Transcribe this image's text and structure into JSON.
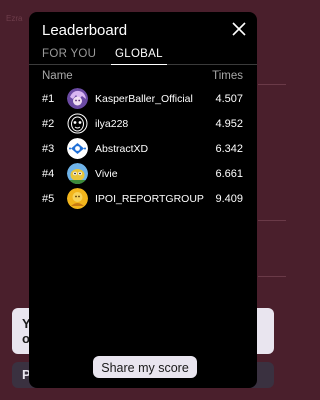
{
  "background": {
    "faint_label": "Ezra",
    "card_text": "Yo",
    "pill_text": "P"
  },
  "modal": {
    "title": "Leaderboard",
    "tabs": [
      {
        "label": "FOR YOU",
        "active": false
      },
      {
        "label": "GLOBAL",
        "active": true
      }
    ],
    "columns": {
      "name": "Name",
      "times": "Times"
    },
    "rows": [
      {
        "rank": "#1",
        "name": "KasperBaller_Official",
        "time": "4.507",
        "avatar": "purple-anime-avatar"
      },
      {
        "rank": "#2",
        "name": "ilya228",
        "time": "4.952",
        "avatar": "mask-avatar"
      },
      {
        "rank": "#3",
        "name": "AbstractXD",
        "time": "6.342",
        "avatar": "blue-abstract-avatar"
      },
      {
        "rank": "#4",
        "name": "Vivie",
        "time": "6.661",
        "avatar": "character-avatar"
      },
      {
        "rank": "#5",
        "name": "IPOI_REPORTGROUP",
        "time": "9.409",
        "avatar": "yellow-avatar"
      }
    ],
    "share_label": "Share my score"
  },
  "colors": {
    "page_bg": "#4a1f2c",
    "modal_bg": "#000000",
    "button_bg": "#e9e5ef"
  }
}
